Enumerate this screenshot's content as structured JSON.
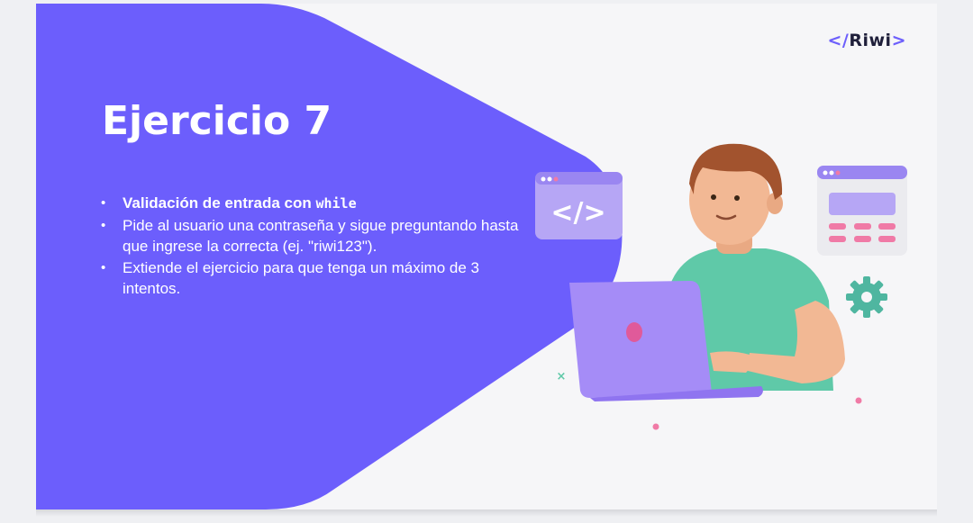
{
  "slide": {
    "logo": {
      "left": "</",
      "word": "Riwi",
      "right": ">"
    },
    "title": "Ejercicio 7",
    "bullets": [
      {
        "text": "Validación de entrada con ",
        "code": "while"
      },
      {
        "text": "Pide al usuario una contraseña y sigue preguntando hasta que ingrese la correcta (ej. \"riwi123\")."
      },
      {
        "text": "Extiende el ejercicio para que tenga un máximo de 3 intentos."
      }
    ],
    "illustration": {
      "code_window_symbol": "</>",
      "icons": [
        "code-window-icon",
        "calculator-window-icon",
        "gear-icon",
        "laptop-icon",
        "person-illustration"
      ]
    }
  },
  "colors": {
    "brand_purple": "#6c5efc",
    "background": "#f6f6f8",
    "shirt_teal": "#5fc9a8",
    "laptop_lavender": "#a58cf7"
  }
}
